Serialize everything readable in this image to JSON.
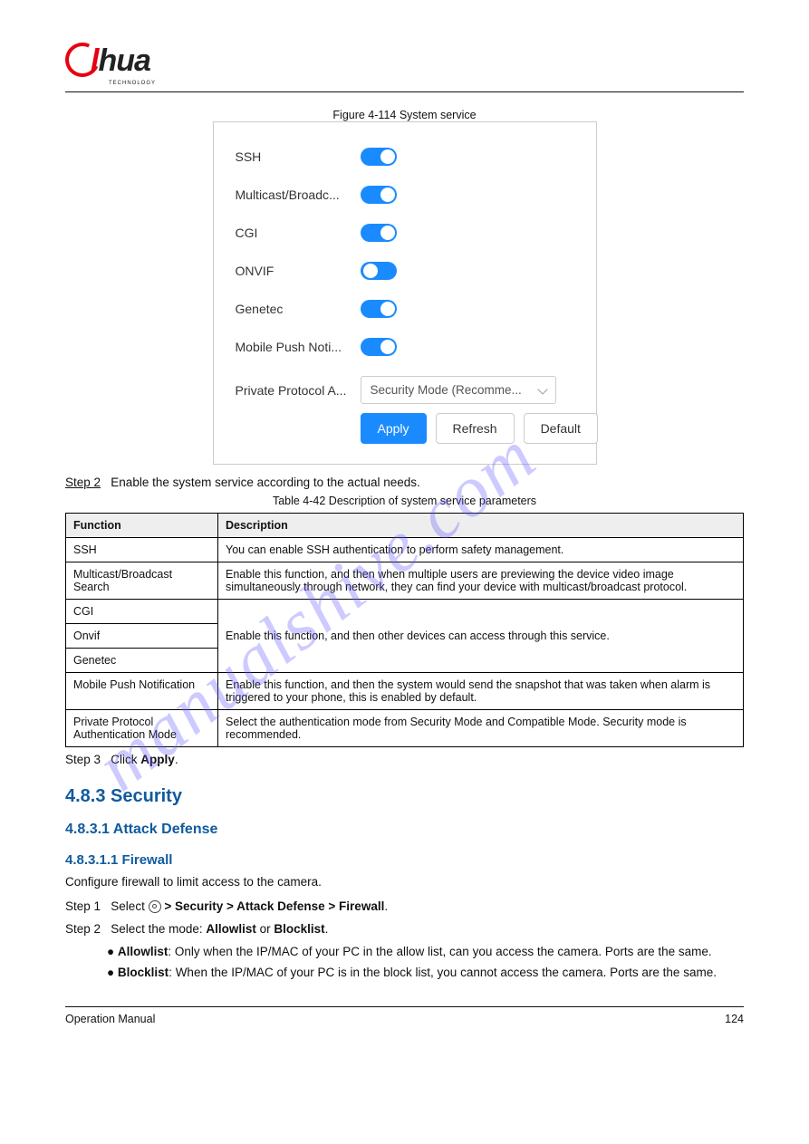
{
  "logo": {
    "brand": "alhua",
    "sub": "TECHNOLOGY"
  },
  "watermark": "manualshive.com",
  "figure_caption": "Figure 4-114 System service",
  "panel": {
    "items": [
      {
        "label": "SSH"
      },
      {
        "label": "Multicast/Broadc..."
      },
      {
        "label": "CGI"
      },
      {
        "label": "ONVIF"
      },
      {
        "label": "Genetec"
      },
      {
        "label": "Mobile Push Noti..."
      }
    ],
    "protocol_label": "Private Protocol A...",
    "protocol_value": "Security Mode (Recomme...",
    "buttons": {
      "apply": "Apply",
      "refresh": "Refresh",
      "defaultb": "Default"
    }
  },
  "step2_prefix": "Step 2",
  "step2_text": "Enable the system service according to the actual needs.",
  "table_caption": "Table 4-42 Description of system service parameters",
  "table": {
    "headers": [
      "Function",
      "Description"
    ],
    "rows": [
      {
        "c1": "SSH",
        "c2": "You can enable SSH authentication to perform safety management."
      },
      {
        "c1": "Multicast/Broadcast Search",
        "c2": "Enable this function, and then when multiple users are previewing the device video image simultaneously through network, they can find your device with multicast/broadcast protocol."
      },
      {
        "c1": "CGI"
      },
      {
        "c1": "Onvif"
      },
      {
        "c1": "Genetec"
      },
      {
        "merged_c2": "Enable this function, and then other devices can access through this service."
      },
      {
        "c1": "Mobile Push Notification",
        "c2": "Enable this function, and then the system would send the snapshot that was taken when alarm is triggered to your phone, this is enabled by default."
      },
      {
        "c1": "Private Protocol Authentication Mode",
        "c2": "Select the authentication mode from Security Mode and Compatible Mode. Security mode is recommended."
      }
    ]
  },
  "step3_prefix": "Step 3",
  "step3_text_a": "Click ",
  "step3_text_b": "Apply",
  "step3_text_c": ".",
  "headings": {
    "h1": "4.8.3 Security",
    "h2a": "4.8.3.1 Attack Defense",
    "h3a": "4.8.3.1.1 Firewall"
  },
  "body": {
    "p1a": "Configure firewall to limit access to the camera.",
    "s1_prefix": "Step 1",
    "s1_a": "Select ",
    "s1_b": " > Security > Attack Defense > Firewall",
    "s1_c": ".",
    "s2_prefix": "Step 2",
    "s2_a": "Select the mode: ",
    "s2_b": "Allowlist",
    "s2_c": " or ",
    "s2_d": "Blocklist",
    "s2_e": ".",
    "bullet1a": "Allowlist",
    "bullet1b": ": Only when the IP/MAC of your PC in the allow list, can you access the camera. Ports are the same.",
    "bullet2a": "Blocklist",
    "bullet2b": ": When the IP/MAC of your PC is in the block list, you cannot access the camera. Ports are the same."
  },
  "footer": {
    "left": "Operation Manual",
    "right": "124"
  }
}
